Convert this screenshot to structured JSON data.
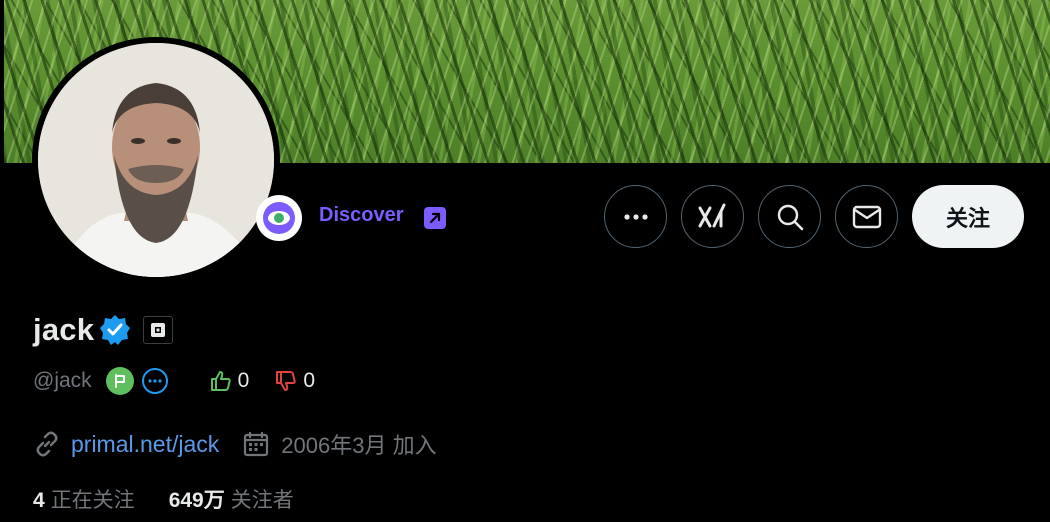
{
  "profile": {
    "name": "jack",
    "handle": "@jack",
    "discover_label": "Discover",
    "follow_label": "关注",
    "upvotes": "0",
    "downvotes": "0",
    "website": "primal.net/jack",
    "joined": "2006年3月 加入",
    "following_count": "4",
    "following_label": "正在关注",
    "followers_count": "649万",
    "followers_label": "关注者"
  },
  "icons": {
    "more": "more-horizontal-icon",
    "grok": "xai-grok-icon",
    "search": "search-icon",
    "message": "envelope-icon",
    "verified": "verified-badge-icon",
    "affiliation": "square-org-badge-icon",
    "link": "link-icon",
    "calendar": "calendar-icon",
    "thumbs_up": "thumbs-up-icon",
    "thumbs_down": "thumbs-down-icon",
    "discover": "eye-icon",
    "external": "external-arrow-icon"
  },
  "colors": {
    "background": "#000000",
    "discover_accent": "#7c5cff",
    "link": "#5b9ae8",
    "verified": "#1d9bf0",
    "muted_text": "#71767b",
    "up_vote": "#5fbf5f",
    "down_vote": "#e0443a"
  }
}
